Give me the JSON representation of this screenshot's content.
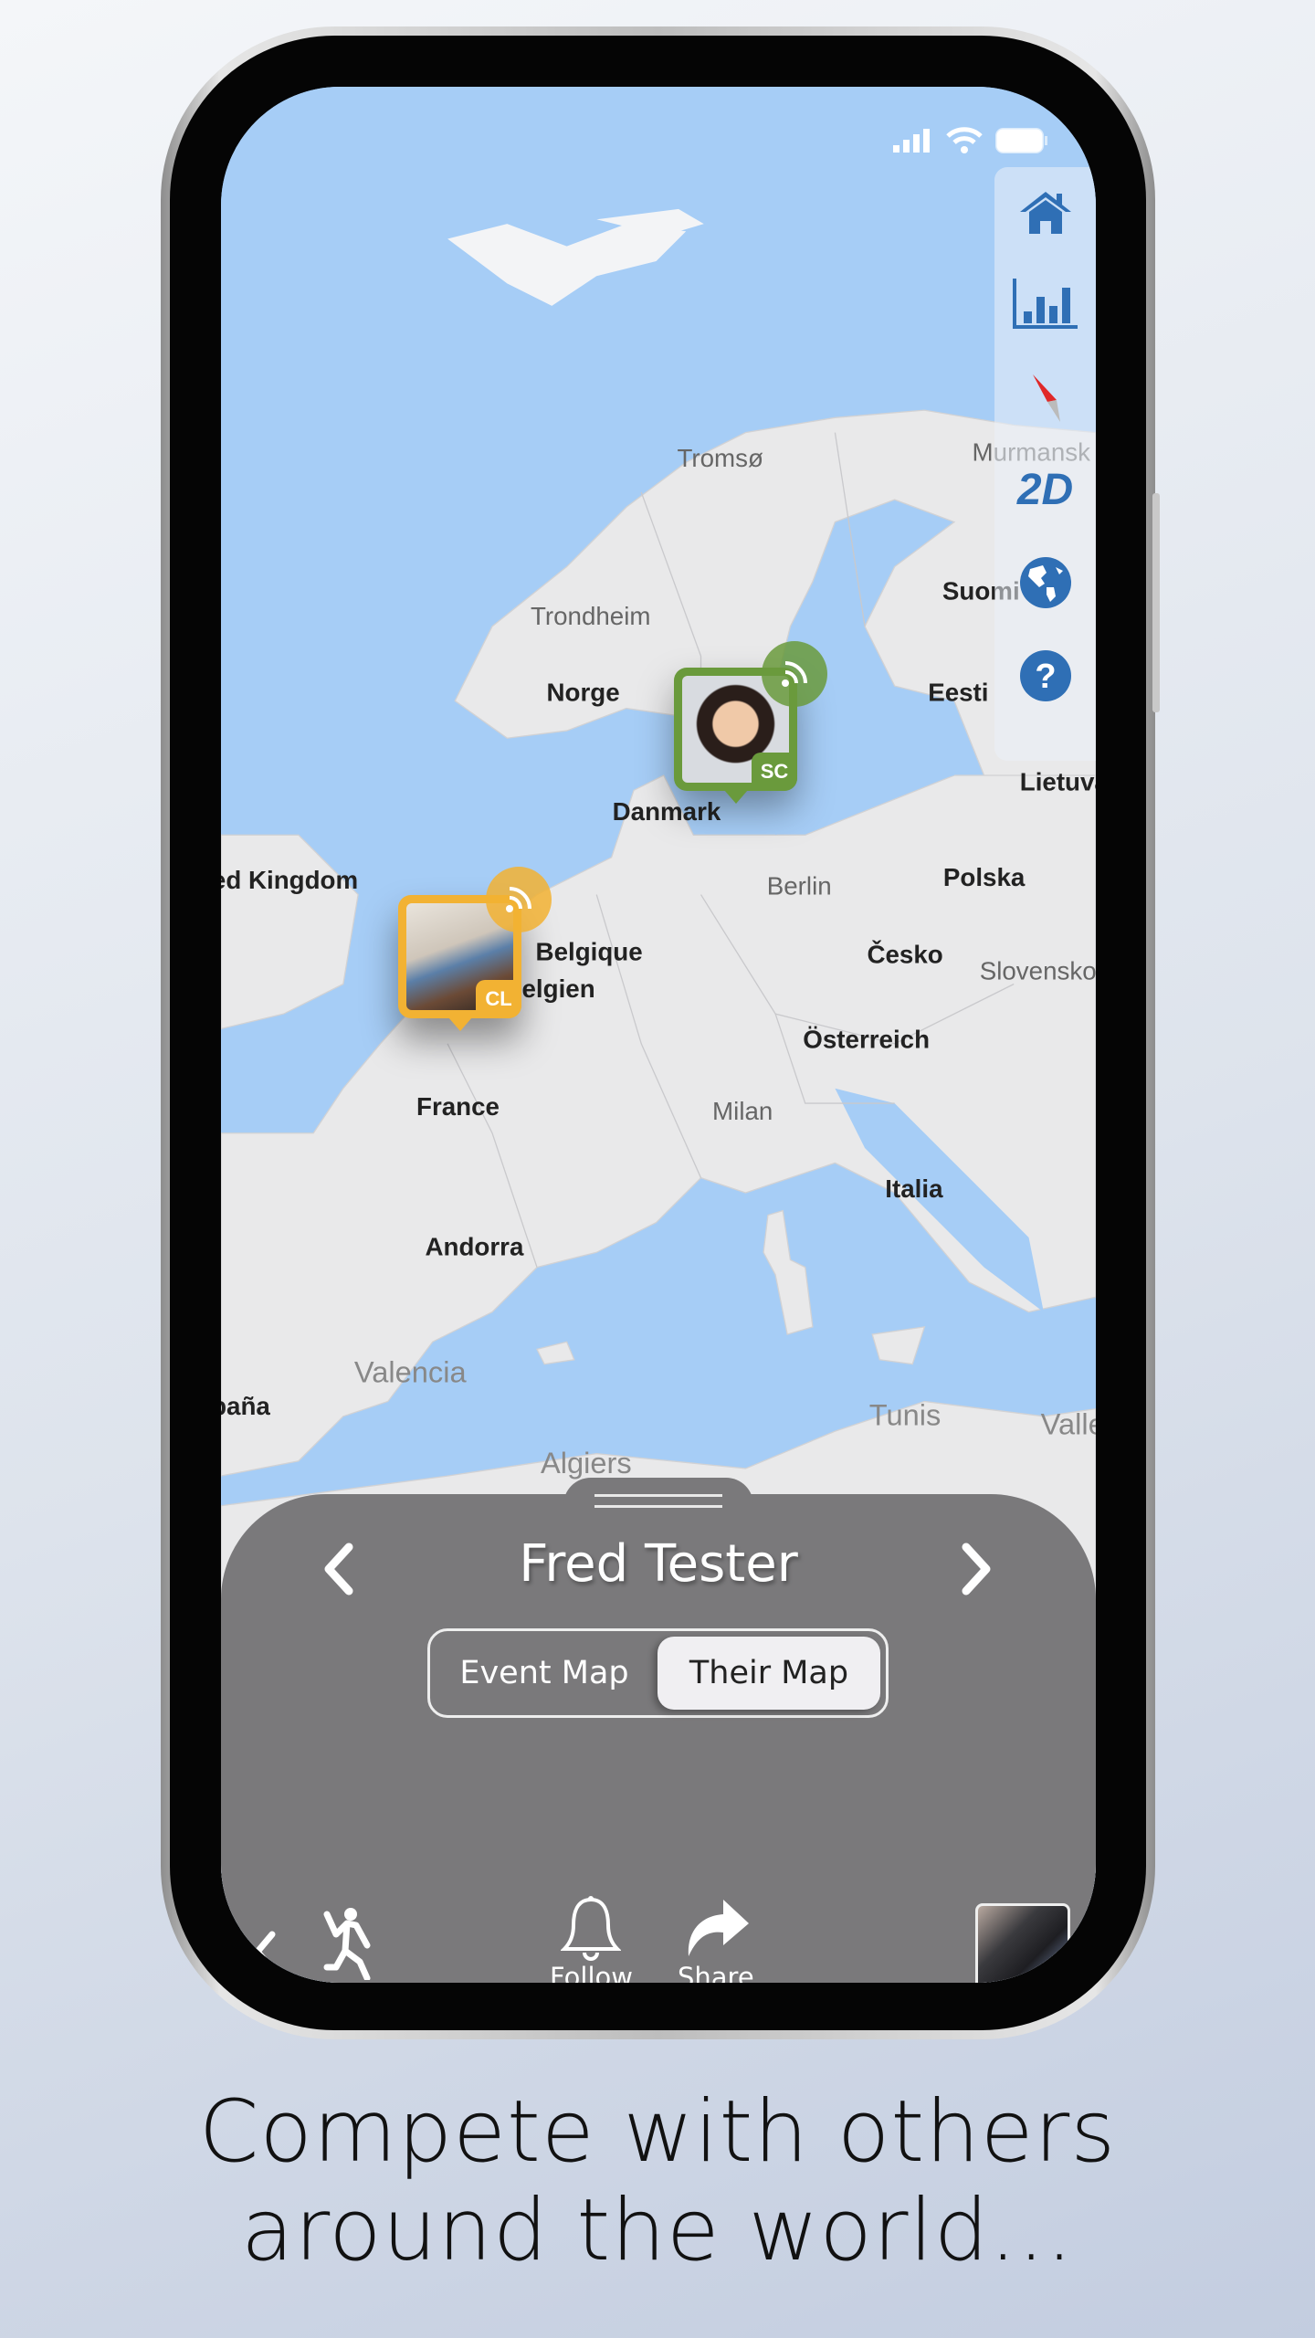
{
  "map": {
    "labels": {
      "tromso": "Tromsø",
      "murmansk": "Murmansk",
      "trondheim": "Trondheim",
      "suomi": "Suomi",
      "norge": "Norge",
      "danmark": "Danmark",
      "eesti": "Eesti",
      "lietuva": "Lietuva",
      "uk": "United Kingdom",
      "polska": "Polska",
      "berlin": "Berlin",
      "belgique": "Belgique",
      "belgien": "Belgien",
      "cesko": "Česko",
      "slovensko": "Slovensko",
      "osterreich": "Österreich",
      "france": "France",
      "milan": "Milan",
      "italia": "Italia",
      "andorra": "Andorra",
      "valencia": "Valencia",
      "espana": "España",
      "tunis": "Tunis",
      "valletta": "Valletta",
      "algiers": "Algiers"
    },
    "colors": {
      "sea": "#a6cdf6",
      "land": "#e9e9ea"
    }
  },
  "sidebar": {
    "items": [
      {
        "icon": "home-icon"
      },
      {
        "icon": "bar-chart-icon"
      },
      {
        "icon": "compass-icon"
      },
      {
        "icon": "view-mode",
        "label": "2D"
      },
      {
        "icon": "globe-icon"
      },
      {
        "icon": "help-icon"
      }
    ],
    "accent": "#2f6fb5"
  },
  "markers": [
    {
      "initials": "SC",
      "color": "#6a9a3c",
      "icon": "broadcast-icon"
    },
    {
      "initials": "CL",
      "color": "#f2b233",
      "icon": "broadcast-icon"
    }
  ],
  "panel": {
    "name": "Fred Tester",
    "toggle": {
      "options": [
        "Event Map",
        "Their Map"
      ],
      "selected": "Their Map"
    },
    "actions": {
      "follow": "Follow",
      "share": "Share"
    }
  },
  "caption": {
    "line1": "Compete with others",
    "line2": "around the world..."
  }
}
